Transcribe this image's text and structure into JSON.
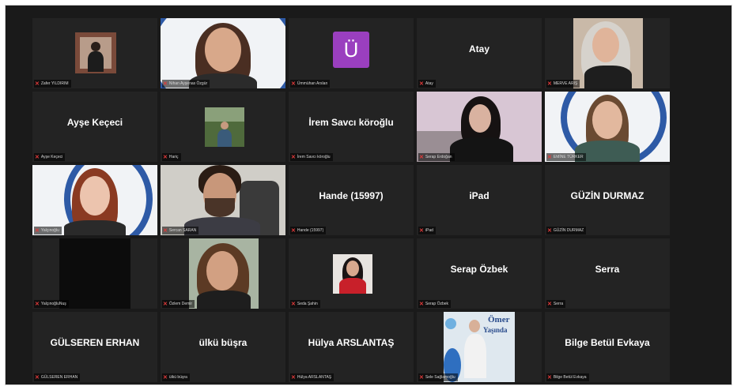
{
  "participants": [
    {
      "label": "Zafer YILDIRIM",
      "display": ""
    },
    {
      "label": "Nihan Ayşenas Özgür",
      "display": ""
    },
    {
      "label": "Ümmühan Arslan",
      "display": "",
      "avatar_letter": "Ü",
      "avatar_color": "#9a3fbf"
    },
    {
      "label": "Atay",
      "display": "Atay"
    },
    {
      "label": "MERVE ARIŞ",
      "display": ""
    },
    {
      "label": "Ayşe Keçeci",
      "display": "Ayşe Keçeci"
    },
    {
      "label": "Hariç",
      "display": ""
    },
    {
      "label": "İrem Savcı köroğlu",
      "display": "İrem Savcı köroğlu"
    },
    {
      "label": "Serap Erdoğan",
      "display": ""
    },
    {
      "label": "EMİNE TÜRKER",
      "display": ""
    },
    {
      "label": "Yalçınoğlu",
      "display": ""
    },
    {
      "label": "Sercan SARAN",
      "display": ""
    },
    {
      "label": "Hande (15997)",
      "display": "Hande (15997)"
    },
    {
      "label": "iPad",
      "display": "iPad"
    },
    {
      "label": "GÜZİN DURMAZ",
      "display": "GÜZİN DURMAZ"
    },
    {
      "label": "YalçınoğluNuş",
      "display": ""
    },
    {
      "label": "Özlem Demir",
      "display": ""
    },
    {
      "label": "Seda Şahin",
      "display": ""
    },
    {
      "label": "Serap Özbek",
      "display": "Serap Özbek"
    },
    {
      "label": "Serra",
      "display": "Serra"
    },
    {
      "label": "GÜLSEREN ERHAN",
      "display": "GÜLSEREN ERHAN"
    },
    {
      "label": "ülkü büşra",
      "display": "ülkü büşra"
    },
    {
      "label": "Hülya ARSLANTAŞ",
      "display": "Hülya ARSLANTAŞ"
    },
    {
      "label": "Sele Sağlamoğlu",
      "display": "",
      "photo_text_line1": "Ömer",
      "photo_text_line2": "Yaşında"
    },
    {
      "label": "Bilge Betül Evkaya",
      "display": "Bilge Betül Evkaya"
    }
  ],
  "icons": {
    "muted_mic": "muted-mic-icon"
  },
  "colors": {
    "tile_bg": "#232323",
    "active_speaker": "#c8e04a",
    "mute_red": "#e23a3a"
  }
}
